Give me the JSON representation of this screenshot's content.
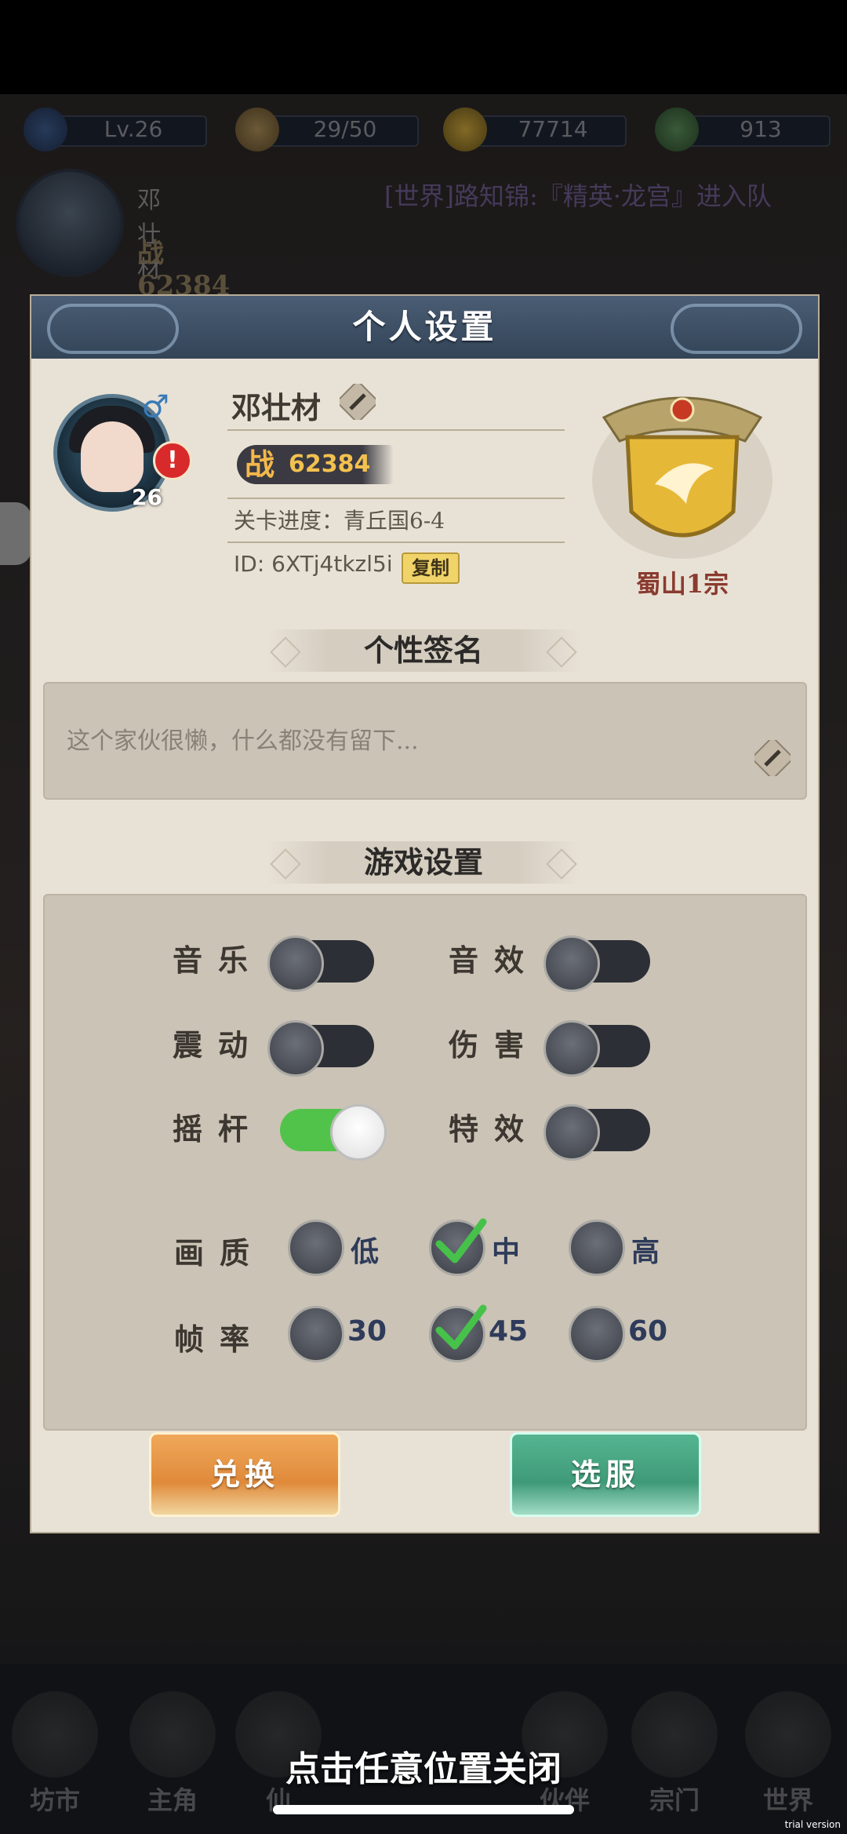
{
  "resources": [
    {
      "icon": "level-icon",
      "value": "Lv.26"
    },
    {
      "icon": "stamina-bun-icon",
      "value": "29/50"
    },
    {
      "icon": "copper-coin-icon",
      "value": "77714"
    },
    {
      "icon": "jade-leaf-icon",
      "value": "913"
    }
  ],
  "player_bar": {
    "name": "邓壮材",
    "power": "战 62384"
  },
  "ticker": "[世界]路知锦:『精英·龙宫』进入队",
  "modal": {
    "title": "个人设置",
    "profile": {
      "name": "邓壮材",
      "gender_symbol": "♂",
      "level": "26",
      "power_glyph": "战",
      "power": "62384",
      "stage": "关卡进度：青丘国6-4",
      "id": "ID: 6XTj4tkzl5i",
      "copy_label": "复制",
      "alert": "!"
    },
    "sect": {
      "name": "蜀山1宗"
    },
    "signature": {
      "title": "个性签名",
      "text": "这个家伙很懒，什么都没有留下..."
    },
    "game_settings": {
      "title": "游戏设置",
      "toggles": [
        {
          "label": "音乐",
          "on": false
        },
        {
          "label": "音效",
          "on": false
        },
        {
          "label": "震动",
          "on": false
        },
        {
          "label": "伤害",
          "on": false
        },
        {
          "label": "摇杆",
          "on": true
        },
        {
          "label": "特效",
          "on": false
        }
      ],
      "quality": {
        "label": "画质",
        "options": [
          "低",
          "中",
          "高"
        ],
        "selected": "中"
      },
      "framerate": {
        "label": "帧率",
        "options": [
          "30",
          "45",
          "60"
        ],
        "selected": "45"
      }
    },
    "buttons": {
      "exchange": "兑换",
      "server": "选服"
    }
  },
  "bottom_nav": [
    "坊市",
    "主角",
    "仙",
    "伙伴",
    "宗门",
    "世界"
  ],
  "close_hint": "点击任意位置关闭",
  "trial_label": "trial version"
}
